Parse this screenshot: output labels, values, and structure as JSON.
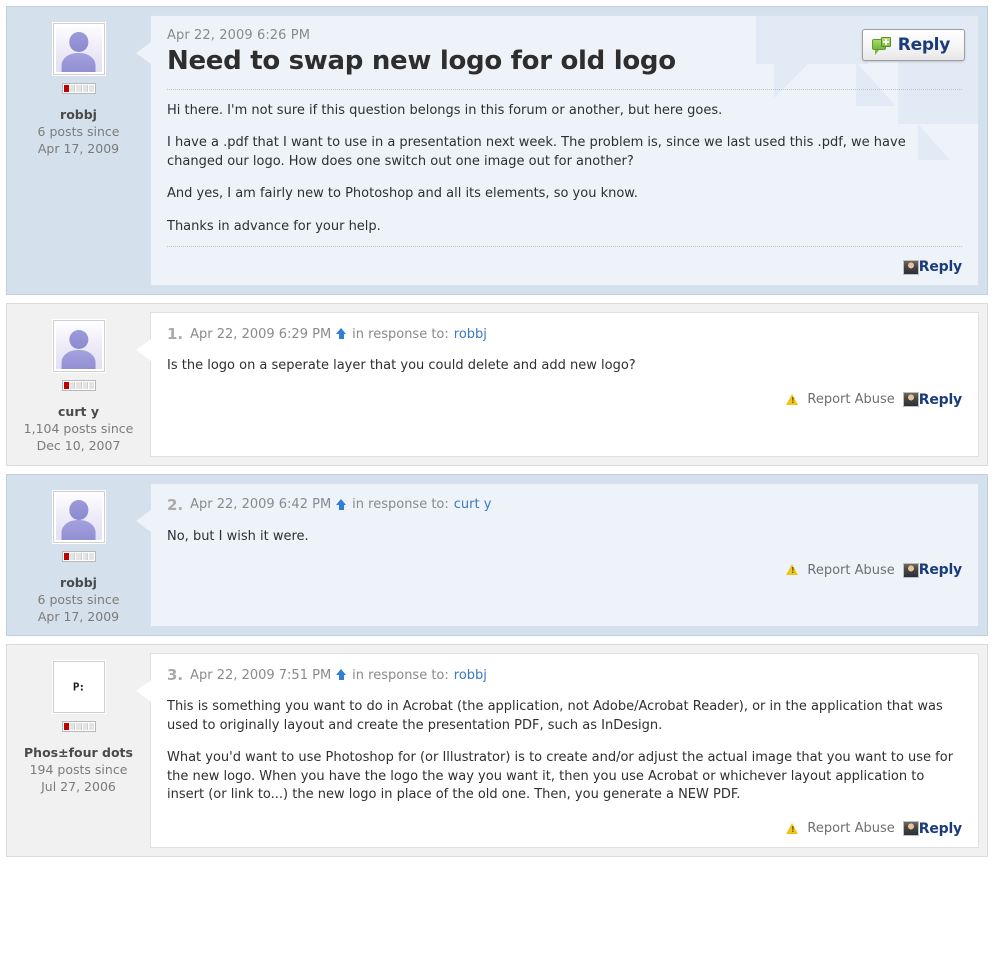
{
  "toolbar": {
    "reply_button_label": "Reply",
    "reply_button_icon": "green-speech-bubble-plus-icon"
  },
  "labels": {
    "report_abuse": "Report Abuse",
    "reply": "Reply",
    "in_response_to": "in response to:",
    "posts_since_suffix": "posts since"
  },
  "colors": {
    "author_post_bg": "#d4e1ec",
    "other_post_bg": "#f1f1f1",
    "author_body_bg": "#eef3fa",
    "other_body_bg": "#ffffff",
    "link": "#3a78c0",
    "reply_text": "#1b3c7a",
    "rank_filled": "#c00000",
    "warn_icon": "#f0c419",
    "watermark": "#e2eaf5"
  },
  "posts": [
    {
      "kind": "topic",
      "highlight": true,
      "author": {
        "name": "robbj",
        "posts_line": "6 posts since",
        "joined_line": "Apr 17, 2009",
        "avatar": "default-person-avatar",
        "rank_filled": 1,
        "rank_total": 5
      },
      "date": "Apr 22, 2009 6:26 PM",
      "title": "Need to swap new logo for old logo",
      "paragraphs": [
        "Hi there. I'm not sure if this question belongs in this forum or another, but here goes.",
        "I have a .pdf that I want to use in a presentation next week. The problem is, since we last used this .pdf, we have changed our logo. How does one switch out one image out for another?",
        "And yes, I am fairly new to Photoshop and all its elements, so you know.",
        "Thanks in advance for your help."
      ],
      "show_report_abuse": false,
      "reply_label": "Reply"
    },
    {
      "kind": "reply",
      "highlight": false,
      "number": "1.",
      "author": {
        "name": "curt y",
        "posts_line": "1,104 posts since",
        "joined_line": "Dec 10, 2007",
        "avatar": "default-person-avatar",
        "rank_filled": 1,
        "rank_total": 5
      },
      "date": "Apr 22, 2009 6:29 PM",
      "response_to": "robbj",
      "paragraphs": [
        "Is the logo on a seperate layer that you could delete and add new logo?"
      ],
      "show_report_abuse": true,
      "reply_label": "Reply"
    },
    {
      "kind": "reply",
      "highlight": true,
      "number": "2.",
      "author": {
        "name": "robbj",
        "posts_line": "6 posts since",
        "joined_line": "Apr 17, 2009",
        "avatar": "default-person-avatar",
        "rank_filled": 1,
        "rank_total": 5
      },
      "date": "Apr 22, 2009 6:42 PM",
      "response_to": "curt y",
      "paragraphs": [
        "No, but I wish it were."
      ],
      "show_report_abuse": true,
      "reply_label": "Reply"
    },
    {
      "kind": "reply",
      "highlight": false,
      "number": "3.",
      "author": {
        "name": "Phos±four dots",
        "posts_line": "194 posts since",
        "joined_line": "Jul 27, 2006",
        "avatar": "pixel-p-dots-avatar",
        "avatar_glyph": "P:",
        "rank_filled": 1,
        "rank_total": 5
      },
      "date": "Apr 22, 2009 7:51 PM",
      "response_to": "robbj",
      "paragraphs": [
        "This is something you want to do in Acrobat (the application, not Adobe/Acrobat Reader), or in the application that was used to originally layout and create the presentation PDF, such as InDesign.",
        "What you'd want to use Photoshop for (or Illustrator) is to create and/or adjust the actual image that you want to use for the new logo. When you have the logo the way you want it, then you use Acrobat or whichever layout application to insert (or link to...) the new logo in place of the old one. Then, you generate a NEW PDF."
      ],
      "show_report_abuse": true,
      "reply_label": "Reply"
    }
  ]
}
